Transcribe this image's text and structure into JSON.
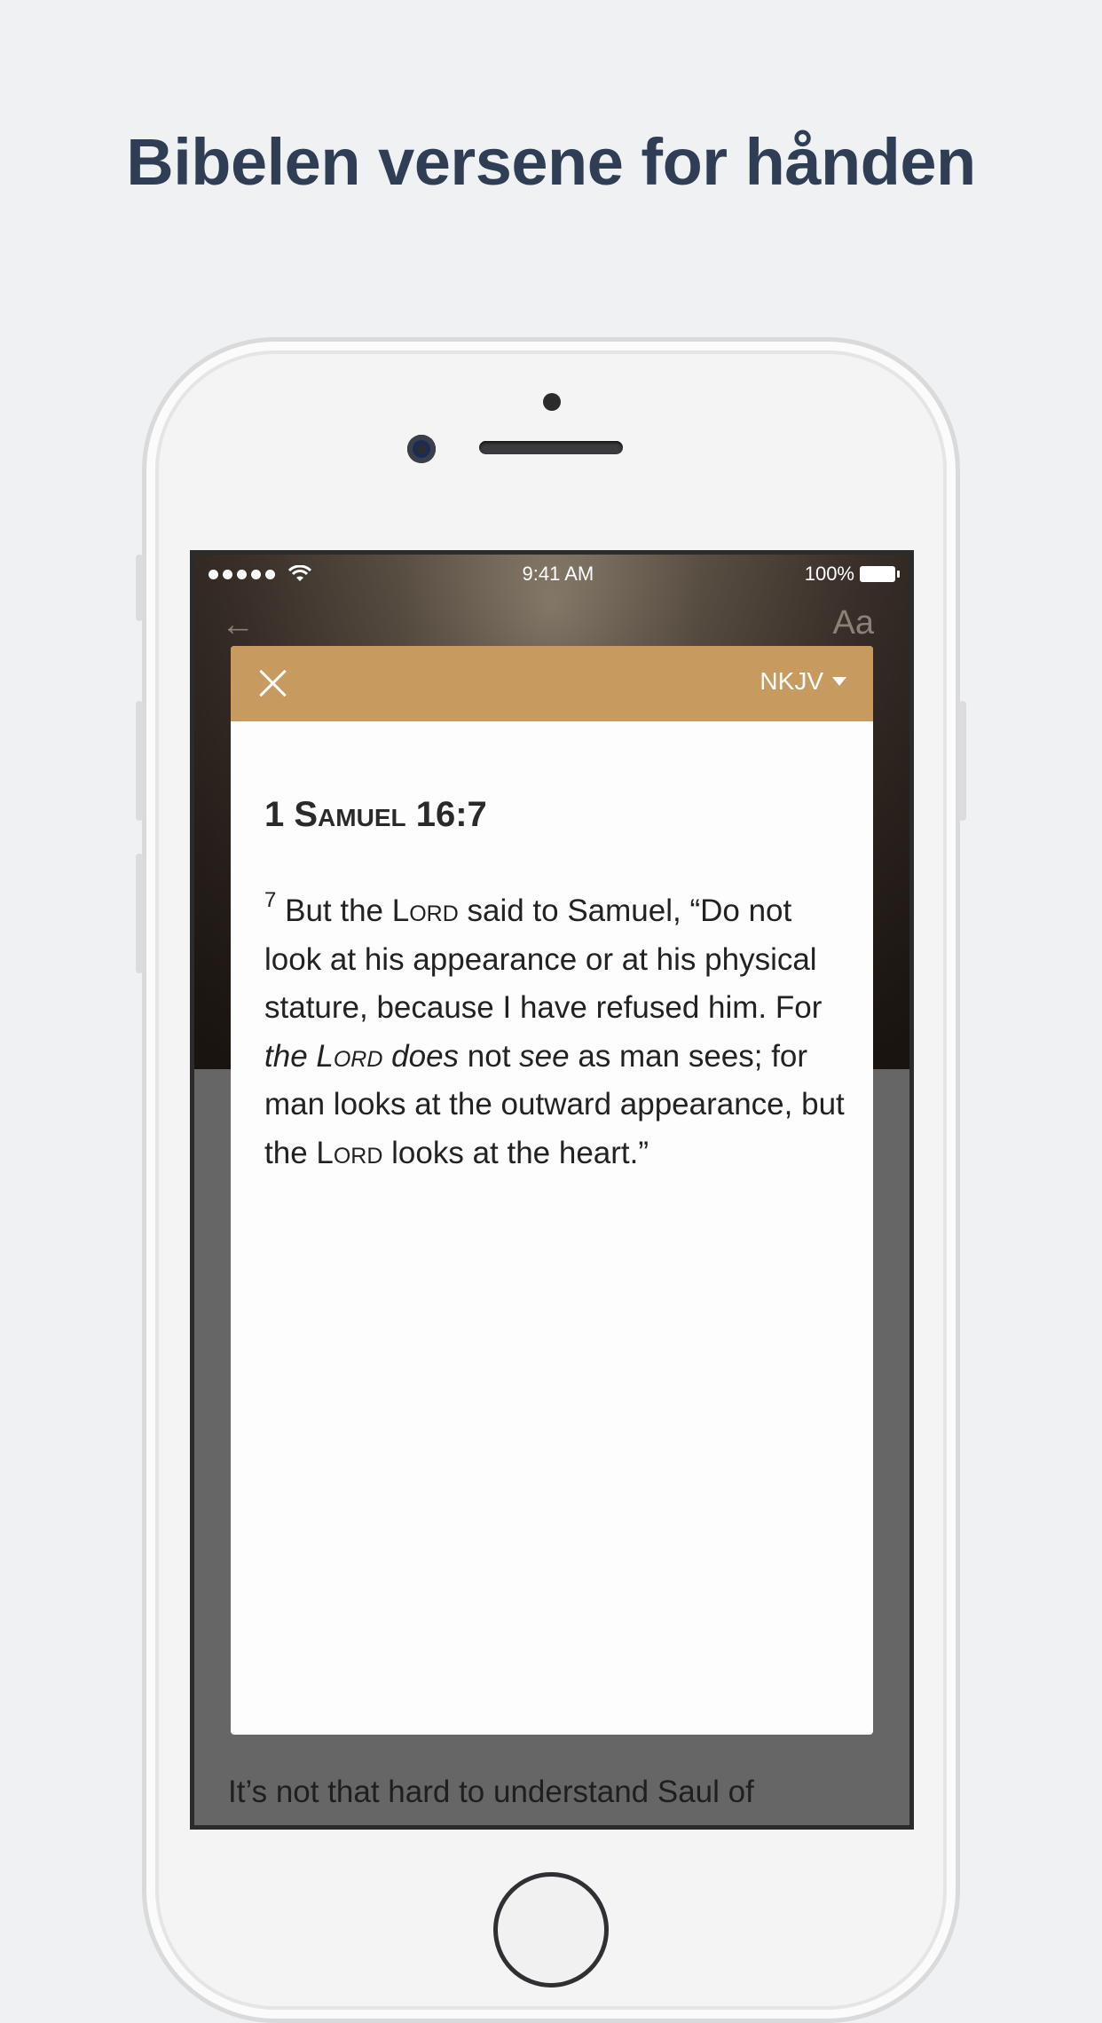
{
  "headline": "Bibelen versene for hånden",
  "status_bar": {
    "time": "9:41 AM",
    "battery": "100%",
    "signal_icon": "signal-dots-icon",
    "wifi_icon": "wifi-icon"
  },
  "nav": {
    "back_icon": "←",
    "text_size_label": "Aa"
  },
  "modal": {
    "close_icon": "close-icon",
    "version_label": "NKJV",
    "reference_num": "1",
    "reference_book": "Samuel",
    "reference_chapter_verse": "16:7",
    "verse_number": "7",
    "verse_parts": {
      "p1": "But the ",
      "lord1": "Lord",
      "p2": " said to Samuel, “Do not look at his appearance or at his physical stature, because I have refused him. For ",
      "it1": "the ",
      "lord2": "Lord",
      "it2": " does",
      "p3": " not ",
      "it3": "see",
      "p4": " as man sees; for man looks at the outward appearance, but the ",
      "lord3": "Lord",
      "p5": " looks at the heart.”"
    }
  },
  "article_snippet": "It’s not that hard to understand Saul of",
  "colors": {
    "headline": "#2f3d55",
    "modal_bar": "#c79a60",
    "background": "#f0f1f3"
  }
}
